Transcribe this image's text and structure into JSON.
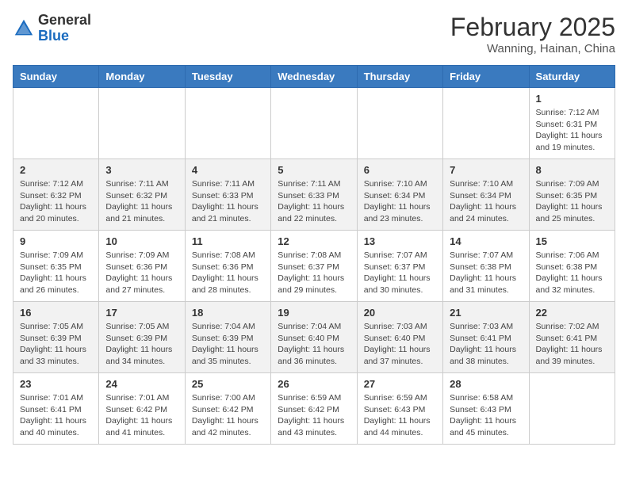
{
  "header": {
    "logo_general": "General",
    "logo_blue": "Blue",
    "month_title": "February 2025",
    "location": "Wanning, Hainan, China"
  },
  "days_of_week": [
    "Sunday",
    "Monday",
    "Tuesday",
    "Wednesday",
    "Thursday",
    "Friday",
    "Saturday"
  ],
  "weeks": [
    [
      {
        "day": "",
        "info": ""
      },
      {
        "day": "",
        "info": ""
      },
      {
        "day": "",
        "info": ""
      },
      {
        "day": "",
        "info": ""
      },
      {
        "day": "",
        "info": ""
      },
      {
        "day": "",
        "info": ""
      },
      {
        "day": "1",
        "info": "Sunrise: 7:12 AM\nSunset: 6:31 PM\nDaylight: 11 hours and 19 minutes."
      }
    ],
    [
      {
        "day": "2",
        "info": "Sunrise: 7:12 AM\nSunset: 6:32 PM\nDaylight: 11 hours and 20 minutes."
      },
      {
        "day": "3",
        "info": "Sunrise: 7:11 AM\nSunset: 6:32 PM\nDaylight: 11 hours and 21 minutes."
      },
      {
        "day": "4",
        "info": "Sunrise: 7:11 AM\nSunset: 6:33 PM\nDaylight: 11 hours and 21 minutes."
      },
      {
        "day": "5",
        "info": "Sunrise: 7:11 AM\nSunset: 6:33 PM\nDaylight: 11 hours and 22 minutes."
      },
      {
        "day": "6",
        "info": "Sunrise: 7:10 AM\nSunset: 6:34 PM\nDaylight: 11 hours and 23 minutes."
      },
      {
        "day": "7",
        "info": "Sunrise: 7:10 AM\nSunset: 6:34 PM\nDaylight: 11 hours and 24 minutes."
      },
      {
        "day": "8",
        "info": "Sunrise: 7:09 AM\nSunset: 6:35 PM\nDaylight: 11 hours and 25 minutes."
      }
    ],
    [
      {
        "day": "9",
        "info": "Sunrise: 7:09 AM\nSunset: 6:35 PM\nDaylight: 11 hours and 26 minutes."
      },
      {
        "day": "10",
        "info": "Sunrise: 7:09 AM\nSunset: 6:36 PM\nDaylight: 11 hours and 27 minutes."
      },
      {
        "day": "11",
        "info": "Sunrise: 7:08 AM\nSunset: 6:36 PM\nDaylight: 11 hours and 28 minutes."
      },
      {
        "day": "12",
        "info": "Sunrise: 7:08 AM\nSunset: 6:37 PM\nDaylight: 11 hours and 29 minutes."
      },
      {
        "day": "13",
        "info": "Sunrise: 7:07 AM\nSunset: 6:37 PM\nDaylight: 11 hours and 30 minutes."
      },
      {
        "day": "14",
        "info": "Sunrise: 7:07 AM\nSunset: 6:38 PM\nDaylight: 11 hours and 31 minutes."
      },
      {
        "day": "15",
        "info": "Sunrise: 7:06 AM\nSunset: 6:38 PM\nDaylight: 11 hours and 32 minutes."
      }
    ],
    [
      {
        "day": "16",
        "info": "Sunrise: 7:05 AM\nSunset: 6:39 PM\nDaylight: 11 hours and 33 minutes."
      },
      {
        "day": "17",
        "info": "Sunrise: 7:05 AM\nSunset: 6:39 PM\nDaylight: 11 hours and 34 minutes."
      },
      {
        "day": "18",
        "info": "Sunrise: 7:04 AM\nSunset: 6:39 PM\nDaylight: 11 hours and 35 minutes."
      },
      {
        "day": "19",
        "info": "Sunrise: 7:04 AM\nSunset: 6:40 PM\nDaylight: 11 hours and 36 minutes."
      },
      {
        "day": "20",
        "info": "Sunrise: 7:03 AM\nSunset: 6:40 PM\nDaylight: 11 hours and 37 minutes."
      },
      {
        "day": "21",
        "info": "Sunrise: 7:03 AM\nSunset: 6:41 PM\nDaylight: 11 hours and 38 minutes."
      },
      {
        "day": "22",
        "info": "Sunrise: 7:02 AM\nSunset: 6:41 PM\nDaylight: 11 hours and 39 minutes."
      }
    ],
    [
      {
        "day": "23",
        "info": "Sunrise: 7:01 AM\nSunset: 6:41 PM\nDaylight: 11 hours and 40 minutes."
      },
      {
        "day": "24",
        "info": "Sunrise: 7:01 AM\nSunset: 6:42 PM\nDaylight: 11 hours and 41 minutes."
      },
      {
        "day": "25",
        "info": "Sunrise: 7:00 AM\nSunset: 6:42 PM\nDaylight: 11 hours and 42 minutes."
      },
      {
        "day": "26",
        "info": "Sunrise: 6:59 AM\nSunset: 6:42 PM\nDaylight: 11 hours and 43 minutes."
      },
      {
        "day": "27",
        "info": "Sunrise: 6:59 AM\nSunset: 6:43 PM\nDaylight: 11 hours and 44 minutes."
      },
      {
        "day": "28",
        "info": "Sunrise: 6:58 AM\nSunset: 6:43 PM\nDaylight: 11 hours and 45 minutes."
      },
      {
        "day": "",
        "info": ""
      }
    ]
  ]
}
